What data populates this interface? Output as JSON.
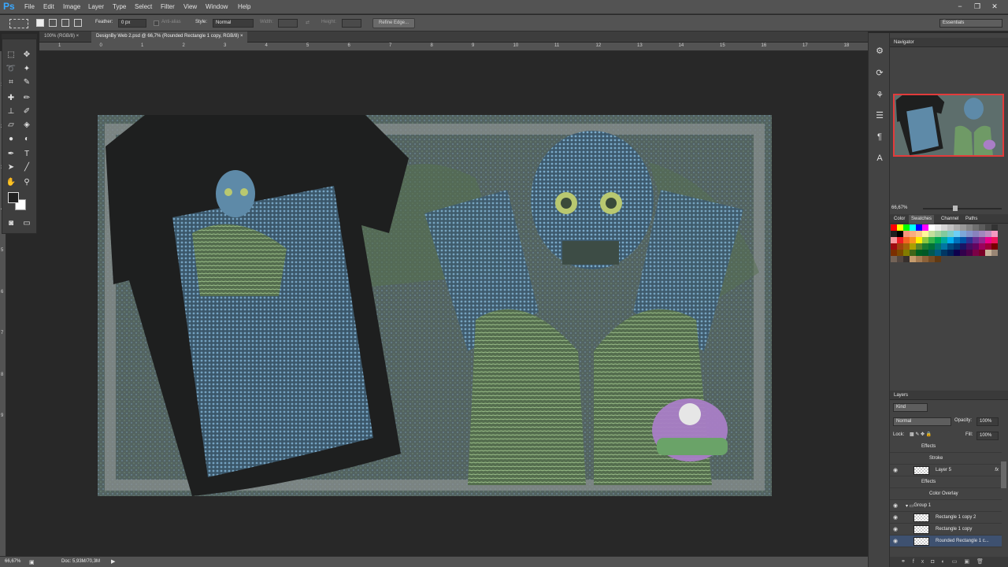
{
  "app": {
    "logo": "Ps"
  },
  "menu": [
    "File",
    "Edit",
    "Image",
    "Layer",
    "Type",
    "Select",
    "Filter",
    "View",
    "Window",
    "Help"
  ],
  "window_controls": {
    "minimize": "−",
    "restore": "❐",
    "close": "✕"
  },
  "options": {
    "feather_label": "Feather:",
    "feather_value": "0 px",
    "antialias_label": "Anti-alias",
    "style_label": "Style:",
    "style_value": "Normal",
    "width_label": "Width:",
    "height_label": "Height:",
    "refine_edge": "Refine Edge...",
    "workspace": "Essentials"
  },
  "tabs": [
    {
      "label": "100% (RGB/8) ×",
      "active": false
    },
    {
      "label": "DesignBy Web 2.psd @ 66,7% (Rounded Rectangle 1 copy, RGB/8) ×",
      "active": true
    }
  ],
  "ruler_h": [
    "1",
    "0",
    "1",
    "2",
    "3",
    "4",
    "5",
    "6",
    "7",
    "8",
    "9",
    "10",
    "11",
    "12",
    "13",
    "14",
    "15",
    "16",
    "17",
    "18"
  ],
  "ruler_v": [
    "1",
    "2",
    "3",
    "4",
    "5",
    "6",
    "7",
    "8",
    "9"
  ],
  "status": {
    "zoom": "66,67%",
    "doc": "Doc: 5,93M/70,3M"
  },
  "panels": {
    "navigator": {
      "title": "Navigator",
      "zoom": "66,67%"
    },
    "color_tabs": [
      "Color",
      "Swatches",
      "Channel",
      "Paths"
    ],
    "layers": {
      "title": "Layers",
      "kind": "Kind",
      "blend": "Normal",
      "opacity_label": "Opacity:",
      "opacity": "100%",
      "lock_label": "Lock:",
      "fill_label": "Fill:",
      "fill": "100%",
      "rows": [
        {
          "label": "Effects",
          "indent": 2,
          "eye": "",
          "thumb": false,
          "fx": ""
        },
        {
          "label": "Stroke",
          "indent": 3,
          "eye": "",
          "thumb": false,
          "fx": ""
        },
        {
          "label": "Layer 5",
          "indent": 1,
          "eye": "👁",
          "thumb": true,
          "fx": "fx"
        },
        {
          "label": "Effects",
          "indent": 2,
          "eye": "",
          "thumb": false,
          "fx": ""
        },
        {
          "label": "Color Overlay",
          "indent": 3,
          "eye": "",
          "thumb": false,
          "fx": ""
        },
        {
          "label": "Group 1",
          "indent": 0,
          "eye": "👁",
          "thumb": false,
          "fx": "",
          "folder": true
        },
        {
          "label": "Rectangle 1 copy 2",
          "indent": 1,
          "eye": "👁",
          "thumb": true,
          "fx": ""
        },
        {
          "label": "Rectangle 1 copy",
          "indent": 1,
          "eye": "👁",
          "thumb": true,
          "fx": ""
        },
        {
          "label": "Rounded Rectangle 1 c...",
          "indent": 1,
          "eye": "👁",
          "thumb": true,
          "fx": "",
          "selected": true
        }
      ]
    }
  },
  "swatch_colors": [
    "#ff0000",
    "#ffff00",
    "#00ff00",
    "#00ffff",
    "#0000ff",
    "#ff00ff",
    "#ffffff",
    "#ebebeb",
    "#d6d6d6",
    "#c2c2c2",
    "#adadad",
    "#999999",
    "#858585",
    "#707070",
    "#5c5c5c",
    "#474747",
    "#333333",
    "#1f1f1f",
    "#000000",
    "#f7977a",
    "#f9ad81",
    "#fdc68a",
    "#fff79a",
    "#c4df9b",
    "#a2d39c",
    "#82ca9d",
    "#7bcdc8",
    "#6ecff6",
    "#7ea7d8",
    "#8493ca",
    "#8882be",
    "#a187be",
    "#bc8dbf",
    "#f49ac2",
    "#f6989d",
    "#ed1c24",
    "#f26522",
    "#f7941d",
    "#fff200",
    "#8dc63f",
    "#39b54a",
    "#00a651",
    "#00a99d",
    "#00aeef",
    "#0072bc",
    "#0054a6",
    "#2e3192",
    "#662d91",
    "#92278f",
    "#ec008c",
    "#ed145b",
    "#9e0b0f",
    "#a0410d",
    "#a36209",
    "#aba000",
    "#598527",
    "#1a7b30",
    "#007236",
    "#00746b",
    "#0076a3",
    "#004b80",
    "#003471",
    "#1b1464",
    "#440e62",
    "#630460",
    "#9e005d",
    "#9e0039",
    "#790000",
    "#7b2e00",
    "#7d4900",
    "#827b00",
    "#406618",
    "#005e20",
    "#005826",
    "#005952",
    "#005b7f",
    "#003663",
    "#002157",
    "#0d004c",
    "#32004b",
    "#4b0049",
    "#7b0046",
    "#7a0026",
    "#c7b299",
    "#998675",
    "#736357",
    "#534741",
    "#37302d",
    "#c69c6d",
    "#a67c52",
    "#8c6239",
    "#754c24",
    "#603913"
  ],
  "navigator_art": "canvas thumbnail"
}
